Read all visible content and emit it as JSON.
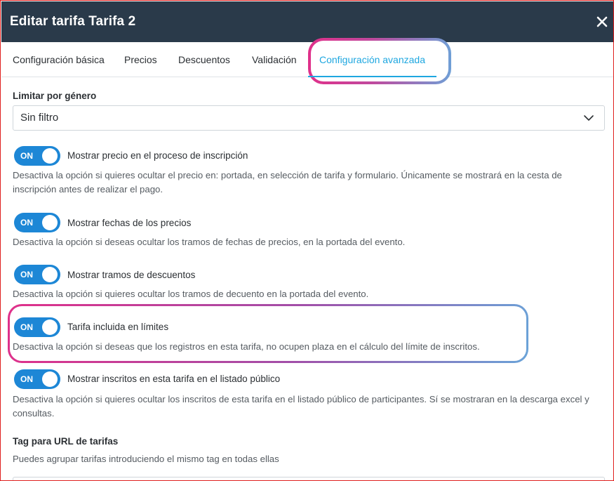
{
  "modal": {
    "title": "Editar tarifa Tarifa 2"
  },
  "tabs": [
    {
      "label": "Configuración básica"
    },
    {
      "label": "Precios"
    },
    {
      "label": "Descuentos"
    },
    {
      "label": "Validación"
    },
    {
      "label": "Configuración avanzada",
      "active": true
    }
  ],
  "gender_filter": {
    "label": "Limitar por género",
    "value": "Sin filtro"
  },
  "options": [
    {
      "state": "ON",
      "label": "Mostrar precio en el proceso de inscripción",
      "description": "Desactiva la opción si quieres ocultar el precio en: portada, en selección de tarifa y formulario. Únicamente se mostrará en la cesta de inscripción antes de realizar el pago."
    },
    {
      "state": "ON",
      "label": "Mostrar fechas de los precios",
      "description": "Desactiva la opción si deseas ocultar los tramos de fechas de precios, en la portada del evento."
    },
    {
      "state": "ON",
      "label": "Mostrar tramos de descuentos",
      "description": "Desactiva la opción si quieres ocultar los tramos de decuento en la portada del evento."
    },
    {
      "state": "ON",
      "label": "Tarifa incluida en límites",
      "description": "Desactiva la opción si deseas que los registros en esta tarifa, no ocupen plaza en el cálculo del límite de inscritos."
    },
    {
      "state": "ON",
      "label": "Mostrar inscritos en esta tarifa en el listado público",
      "description": "Desactiva la opción si quieres ocultar los inscritos de esta tarifa en el listado público de participantes. Sí se mostraran en la descarga excel y consultas."
    }
  ],
  "tag_url": {
    "label": "Tag para URL de tarifas",
    "help": "Puedes agrupar tarifas introduciendo el mismo tag en todas ellas"
  },
  "colors": {
    "header_bg": "#2a3a4a",
    "accent": "#1ea7e0",
    "toggle_on": "#1d87d6",
    "highlight_start": "#e0308a",
    "highlight_end": "#6aa3d8",
    "frame_border": "#e0201e"
  },
  "icons": {
    "close": "close-icon",
    "dropdown": "chevron-down-icon"
  }
}
